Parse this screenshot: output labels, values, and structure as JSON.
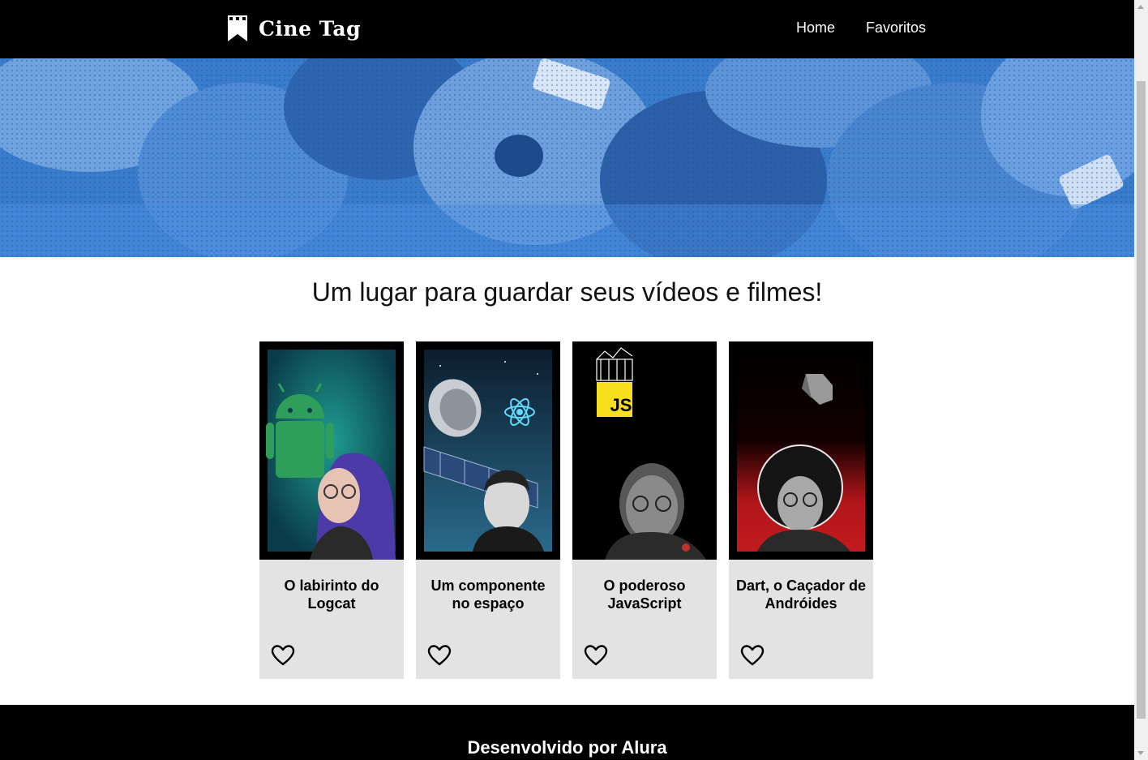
{
  "header": {
    "brand": "Cine Tag",
    "nav": [
      {
        "label": "Home"
      },
      {
        "label": "Favoritos"
      }
    ]
  },
  "main": {
    "headline": "Um lugar para guardar seus vídeos e filmes!",
    "cards": [
      {
        "title": "O labirinto do Logcat",
        "thumbnail": "android-logcat"
      },
      {
        "title": "Um componente no espaço",
        "thumbnail": "react-space"
      },
      {
        "title": "O poderoso JavaScript",
        "thumbnail": "javascript"
      },
      {
        "title": "Dart, o Caçador de Andróides",
        "thumbnail": "dart"
      }
    ],
    "thumb_badge_js": "JS"
  },
  "footer": {
    "text": "Desenvolvido por Alura"
  },
  "icons": {
    "logo": "bookmark-film-icon",
    "favorite": "heart-outline-icon"
  },
  "colors": {
    "header_bg": "#000000",
    "banner_blue": "#3a7fd0",
    "card_bg": "#e3e3e3",
    "footer_bg": "#000000"
  }
}
